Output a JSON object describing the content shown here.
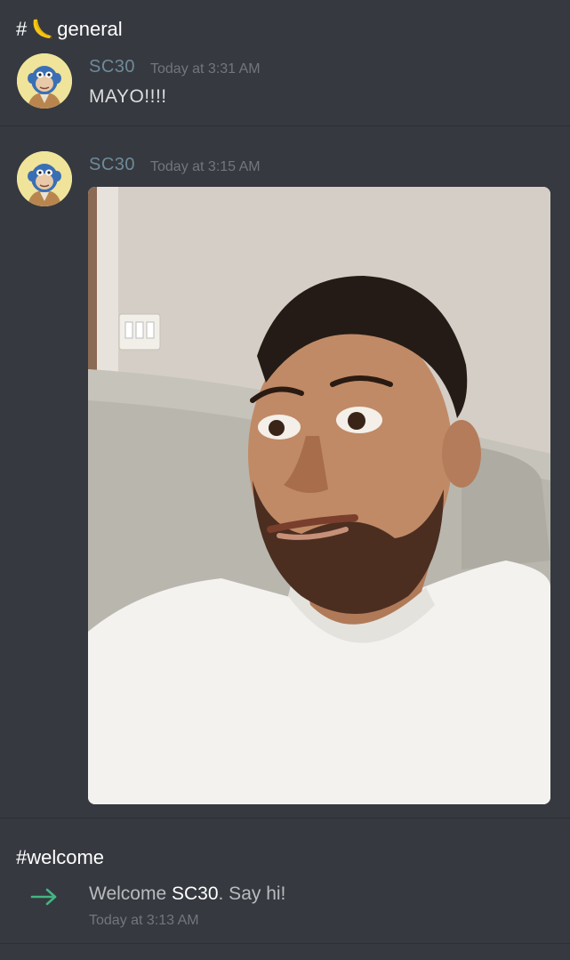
{
  "channel": {
    "hash": "#",
    "emoji_icon": "banana-icon",
    "name": "general"
  },
  "messages": [
    {
      "author": "SC30",
      "timestamp": "Today at 3:31 AM",
      "text": "MAYO!!!!"
    },
    {
      "author": "SC30",
      "timestamp": "Today at 3:15 AM",
      "attachment": "selfie-photo"
    }
  ],
  "welcome": {
    "title": "#welcome",
    "text_prefix": "Welcome ",
    "user": "SC30",
    "text_suffix": ". Say hi!",
    "timestamp": "Today at 3:13 AM",
    "icon": "join-arrow-icon",
    "icon_color": "#43b581"
  },
  "colors": {
    "background": "#36393f",
    "author": "#6f8a99",
    "timestamp": "#72767d"
  }
}
